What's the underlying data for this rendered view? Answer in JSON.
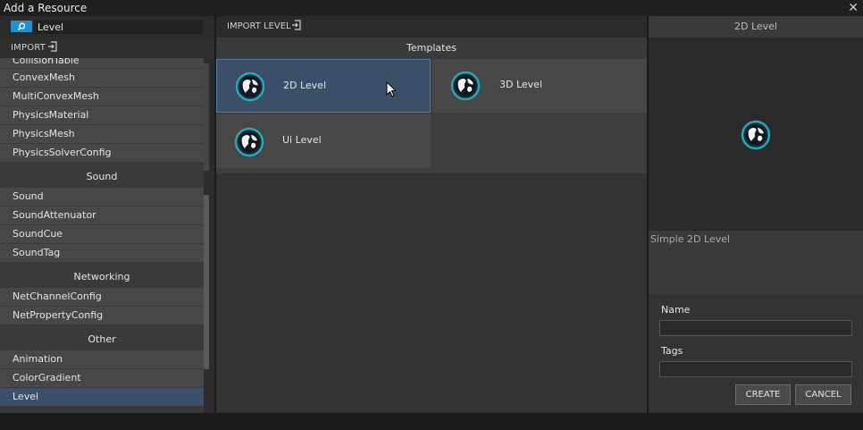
{
  "window": {
    "title": "Add a Resource",
    "close_glyph": "✕"
  },
  "search": {
    "value": "Level",
    "icon": "search-icon"
  },
  "left_import": {
    "label": "IMPORT",
    "icon": "import-icon"
  },
  "list": {
    "partial_item": "CollisionTable",
    "physics_items": [
      "ConvexMesh",
      "MultiConvexMesh",
      "PhysicsMaterial",
      "PhysicsMesh",
      "PhysicsSolverConfig"
    ],
    "sound_header": "Sound",
    "sound_items": [
      "Sound",
      "SoundAttenuator",
      "SoundCue",
      "SoundTag"
    ],
    "networking_header": "Networking",
    "networking_items": [
      "NetChannelConfig",
      "NetPropertyConfig"
    ],
    "other_header": "Other",
    "other_items": [
      "Animation",
      "ColorGradient"
    ],
    "selected_item": "Level"
  },
  "center": {
    "import_label": "IMPORT LEVEL",
    "templates_header": "Templates",
    "tiles": [
      {
        "label": "2D Level",
        "selected": true
      },
      {
        "label": "3D Level",
        "selected": false
      },
      {
        "label": "Ui Level",
        "selected": false
      }
    ]
  },
  "right": {
    "header": "2D Level",
    "description": "Simple 2D Level",
    "name_label": "Name",
    "name_value": "",
    "tags_label": "Tags",
    "tags_value": "",
    "create_label": "CREATE",
    "cancel_label": "CANCEL"
  },
  "colors": {
    "accent": "#1e90d8",
    "selection": "#3b5068",
    "globe_ring": "#2aa7b8"
  }
}
